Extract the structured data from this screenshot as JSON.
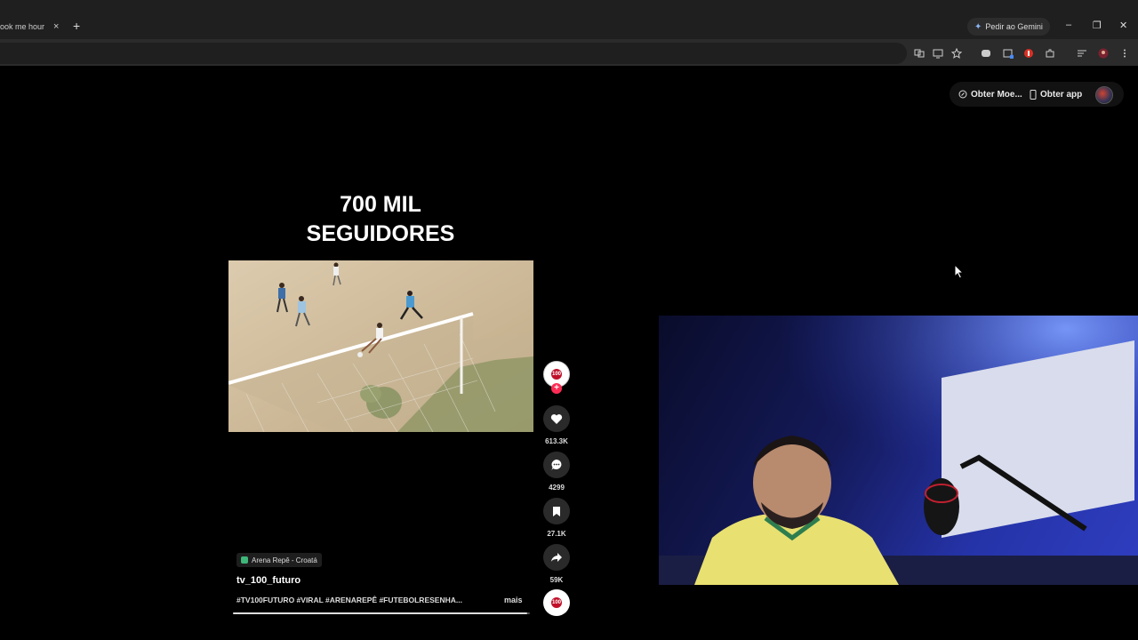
{
  "browser": {
    "tab_title": "ook me hours t",
    "tab_close": "×",
    "new_tab": "+",
    "gemini_label": "Pedir ao Gemini",
    "window_controls": {
      "minimize": "–",
      "restore": "❐",
      "close": "✕"
    }
  },
  "tiktok": {
    "header": {
      "coins_label": "Obter Moe...",
      "app_label": "Obter app"
    },
    "video": {
      "headline_line1": "700 MIL",
      "headline_line2": "SEGUIDORES",
      "progress_fraction": 0.99
    },
    "actions": {
      "likes": "613.3K",
      "comments": "4299",
      "saves": "27.1K",
      "shares": "59K"
    },
    "creator_logo_text": "100",
    "caption": {
      "location": "Arena Repê - Croatá",
      "username": "tv_100_futuro",
      "hashtags": "#TV100FUTURO #VIRAL #ARENAREPÊ #FUTEBOLRESENHA...",
      "more_label": "mais"
    }
  },
  "colors": {
    "accent_follow": "#fe2c55",
    "brand_red": "#c0102a",
    "background": "#000000"
  }
}
